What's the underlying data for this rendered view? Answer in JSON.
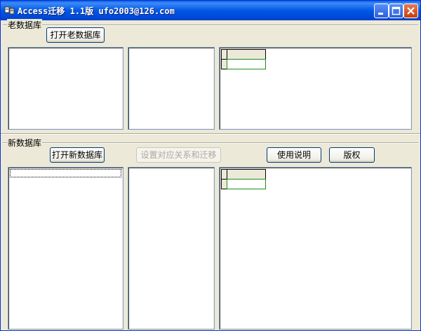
{
  "window": {
    "title": "Access迁移 1.1版 ufo2003@126.com",
    "controls": [
      "minimize",
      "maximize",
      "close"
    ]
  },
  "old_db": {
    "group_label": "老数据库",
    "open_button_label": "打开老数据库"
  },
  "new_db": {
    "group_label": "新数据库",
    "open_button_label": "打开新数据库",
    "map_button_label": "设置对应关系和迁移",
    "map_button_enabled": false,
    "help_button_label": "使用说明",
    "copyright_button_label": "版权"
  },
  "colors": {
    "titlebar": "#0058e6",
    "window_bg": "#ece9d8",
    "grid_cell_border": "#1d8f1d"
  }
}
